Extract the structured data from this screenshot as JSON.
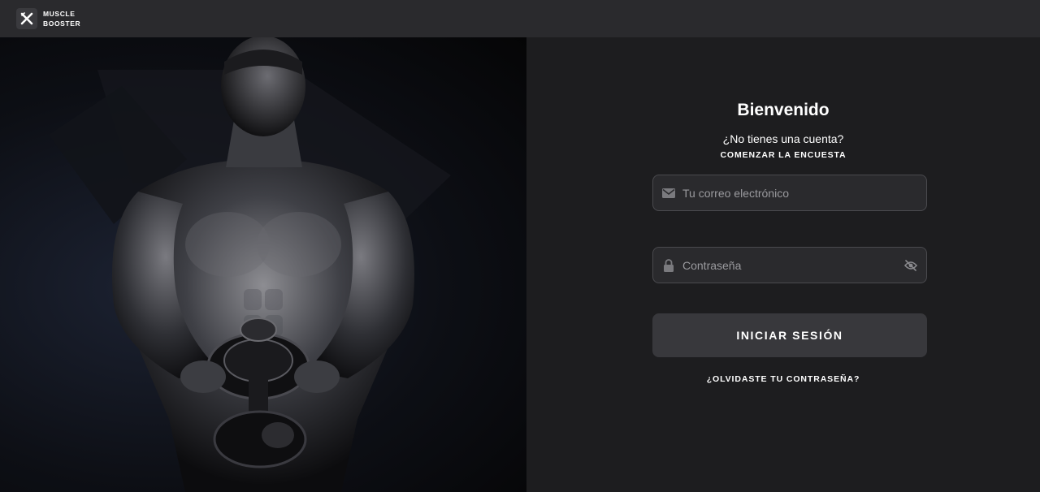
{
  "brand": {
    "line1": "MUSCLE",
    "line2": "BOOSTER",
    "logo_icon": "x-logo-icon"
  },
  "hero": {
    "image": "athlete-with-dumbbell"
  },
  "login": {
    "title": "Bienvenido",
    "no_account": "¿No tienes una cuenta?",
    "survey_link": "COMENZAR LA ENCUESTA",
    "email": {
      "placeholder": "Tu correo electrónico",
      "value": "",
      "icon": "envelope-icon"
    },
    "password": {
      "placeholder": "Contraseña",
      "value": "",
      "icon": "lock-icon",
      "toggle_icon": "eye-slash-icon"
    },
    "submit_label": "INICIAR SESIÓN",
    "forgot_link": "¿OLVIDASTE TU CONTRASEÑA?"
  },
  "colors": {
    "topbar": "#2a2a2d",
    "panel": "#1d1d1f",
    "field": "#2a2a2d",
    "button": "#38383c",
    "text": "#ffffff",
    "placeholder": "#9a9a9e"
  }
}
